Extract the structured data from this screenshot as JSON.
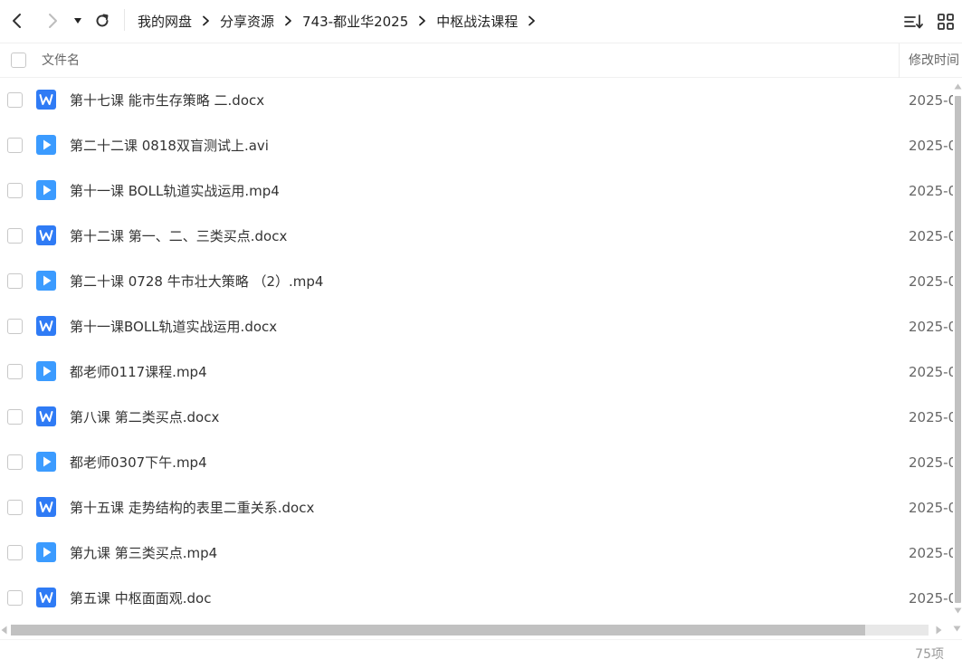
{
  "toolbar": {
    "back_icon": "chevron-left-icon",
    "forward_icon": "chevron-right-icon",
    "dropdown_icon": "caret-down-icon",
    "refresh_icon": "refresh-icon",
    "sort_icon": "sort-list-icon",
    "grid_icon": "grid-view-icon"
  },
  "breadcrumb": [
    "我的网盘",
    "分享资源",
    "743-都业华2025",
    "中枢战法课程"
  ],
  "columns": {
    "name": "文件名",
    "mtime": "修改时间"
  },
  "files": [
    {
      "name": "第十七课 能市生存策略 二.docx",
      "type": "doc",
      "mtime": "2025-0"
    },
    {
      "name": "第二十二课 0818双盲测试上.avi",
      "type": "video",
      "mtime": "2025-0"
    },
    {
      "name": "第十一课 BOLL轨道实战运用.mp4",
      "type": "video",
      "mtime": "2025-0"
    },
    {
      "name": "第十二课 第一、二、三类买点.docx",
      "type": "doc",
      "mtime": "2025-0"
    },
    {
      "name": "第二十课 0728 牛市壮大策略 （2）.mp4",
      "type": "video",
      "mtime": "2025-0"
    },
    {
      "name": "第十一课BOLL轨道实战运用.docx",
      "type": "doc",
      "mtime": "2025-0"
    },
    {
      "name": "都老师0117课程.mp4",
      "type": "video",
      "mtime": "2025-0"
    },
    {
      "name": "第八课 第二类买点.docx",
      "type": "doc",
      "mtime": "2025-0"
    },
    {
      "name": "都老师0307下午.mp4",
      "type": "video",
      "mtime": "2025-0"
    },
    {
      "name": "第十五课 走势结构的表里二重关系.docx",
      "type": "doc",
      "mtime": "2025-0"
    },
    {
      "name": "第九课 第三类买点.mp4",
      "type": "video",
      "mtime": "2025-0"
    },
    {
      "name": "第五课 中枢面面观.doc",
      "type": "doc",
      "mtime": "2025-0"
    }
  ],
  "footer": {
    "count": "75项"
  },
  "colors": {
    "doc_icon": "#2f7bf5",
    "video_icon": "#3b9bff",
    "scroll_thumb": "#c1c1c1"
  }
}
